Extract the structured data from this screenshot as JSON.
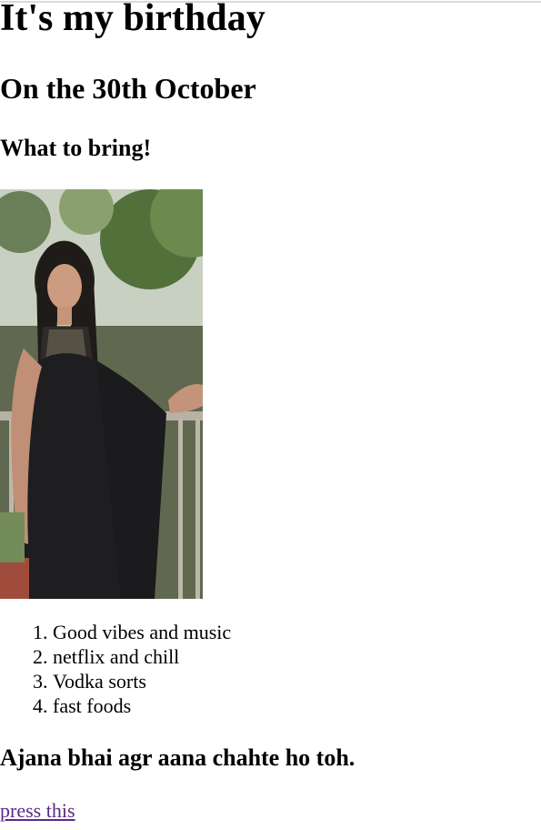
{
  "page": {
    "title": "It's my birthday",
    "date_heading": "On the 30th October",
    "bring_heading": "What to bring!",
    "bring_items": [
      "Good vibes and music",
      "netflix and chill",
      "Vodka sorts",
      "fast foods"
    ],
    "invite_heading": "Ajana bhai agr aana chahte ho toh.",
    "link_text": "press this"
  },
  "colors": {
    "text": "#000000",
    "link_visited": "#5b2a86",
    "background": "#ffffff"
  },
  "icons": {
    "photo": "portrait-photo"
  }
}
